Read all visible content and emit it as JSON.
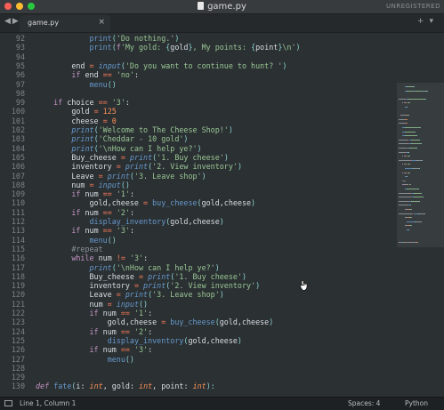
{
  "window": {
    "title": "game.py",
    "watermark": "UNREGISTERED"
  },
  "tabs": [
    {
      "label": "game.py",
      "close_glyph": "×"
    }
  ],
  "nav": {
    "back": "◀",
    "forward": "▶",
    "add": "+",
    "menu": "▾"
  },
  "editor": {
    "lines": [
      {
        "n": "92",
        "toks": [
          [
            "x",
            "            "
          ],
          [
            "fn",
            "print"
          ],
          [
            "par",
            "("
          ],
          [
            "str",
            "'Do nothing.'"
          ],
          [
            "par",
            ")"
          ]
        ]
      },
      {
        "n": "93",
        "toks": [
          [
            "x",
            "            "
          ],
          [
            "fn",
            "print"
          ],
          [
            "par",
            "("
          ],
          [
            "kw",
            "f"
          ],
          [
            "str",
            "'My gold: "
          ],
          [
            "par",
            "{"
          ],
          [
            "x",
            "gold"
          ],
          [
            "par",
            "}"
          ],
          [
            "str",
            ", My points: "
          ],
          [
            "par",
            "{"
          ],
          [
            "x",
            "point"
          ],
          [
            "par",
            "}"
          ],
          [
            "str",
            "\\n'"
          ],
          [
            "par",
            ")"
          ]
        ]
      },
      {
        "n": "94",
        "toks": []
      },
      {
        "n": "95",
        "toks": [
          [
            "x",
            "        end "
          ],
          [
            "op",
            "="
          ],
          [
            "x",
            " "
          ],
          [
            "bi",
            "input"
          ],
          [
            "par",
            "("
          ],
          [
            "str",
            "'Do you want to continue to hunt? '"
          ],
          [
            "par",
            ")"
          ]
        ]
      },
      {
        "n": "96",
        "toks": [
          [
            "x",
            "        "
          ],
          [
            "kw",
            "if"
          ],
          [
            "x",
            " end "
          ],
          [
            "op",
            "=="
          ],
          [
            "x",
            " "
          ],
          [
            "str",
            "'no'"
          ],
          [
            "x",
            ":"
          ]
        ]
      },
      {
        "n": "97",
        "toks": [
          [
            "x",
            "            "
          ],
          [
            "fn",
            "menu"
          ],
          [
            "par",
            "()"
          ]
        ]
      },
      {
        "n": "98",
        "toks": []
      },
      {
        "n": "99",
        "toks": [
          [
            "x",
            "    "
          ],
          [
            "kw",
            "if"
          ],
          [
            "x",
            " choice "
          ],
          [
            "op",
            "=="
          ],
          [
            "x",
            " "
          ],
          [
            "str",
            "'3'"
          ],
          [
            "x",
            ":"
          ]
        ]
      },
      {
        "n": "100",
        "toks": [
          [
            "x",
            "        gold "
          ],
          [
            "op",
            "="
          ],
          [
            "x",
            " "
          ],
          [
            "num",
            "125"
          ]
        ]
      },
      {
        "n": "101",
        "toks": [
          [
            "x",
            "        cheese "
          ],
          [
            "op",
            "="
          ],
          [
            "x",
            " "
          ],
          [
            "num",
            "0"
          ]
        ]
      },
      {
        "n": "102",
        "toks": [
          [
            "x",
            "        "
          ],
          [
            "bi",
            "print"
          ],
          [
            "par",
            "("
          ],
          [
            "str",
            "'Welcome to The Cheese Shop!'"
          ],
          [
            "par",
            ")"
          ]
        ]
      },
      {
        "n": "103",
        "toks": [
          [
            "x",
            "        "
          ],
          [
            "bi",
            "print"
          ],
          [
            "par",
            "("
          ],
          [
            "str",
            "'Cheddar - 10 gold'"
          ],
          [
            "par",
            ")"
          ]
        ]
      },
      {
        "n": "104",
        "toks": [
          [
            "x",
            "        "
          ],
          [
            "bi",
            "print"
          ],
          [
            "par",
            "("
          ],
          [
            "str",
            "'\\nHow can I help ye?'"
          ],
          [
            "par",
            ")"
          ]
        ]
      },
      {
        "n": "105",
        "toks": [
          [
            "x",
            "        Buy_cheese "
          ],
          [
            "op",
            "="
          ],
          [
            "x",
            " "
          ],
          [
            "bi",
            "print"
          ],
          [
            "par",
            "("
          ],
          [
            "str",
            "'1. Buy cheese'"
          ],
          [
            "par",
            ")"
          ]
        ]
      },
      {
        "n": "106",
        "toks": [
          [
            "x",
            "        inventory "
          ],
          [
            "op",
            "="
          ],
          [
            "x",
            " "
          ],
          [
            "bi",
            "print"
          ],
          [
            "par",
            "("
          ],
          [
            "str",
            "'2. View inventory'"
          ],
          [
            "par",
            ")"
          ]
        ]
      },
      {
        "n": "107",
        "toks": [
          [
            "x",
            "        Leave "
          ],
          [
            "op",
            "="
          ],
          [
            "x",
            " "
          ],
          [
            "bi",
            "print"
          ],
          [
            "par",
            "("
          ],
          [
            "str",
            "'3. Leave shop'"
          ],
          [
            "par",
            ")"
          ]
        ]
      },
      {
        "n": "108",
        "toks": [
          [
            "x",
            "        num "
          ],
          [
            "op",
            "="
          ],
          [
            "x",
            " "
          ],
          [
            "bi",
            "input"
          ],
          [
            "par",
            "()"
          ]
        ]
      },
      {
        "n": "109",
        "toks": [
          [
            "x",
            "        "
          ],
          [
            "kw",
            "if"
          ],
          [
            "x",
            " num "
          ],
          [
            "op",
            "=="
          ],
          [
            "x",
            " "
          ],
          [
            "str",
            "'1'"
          ],
          [
            "x",
            ":"
          ]
        ]
      },
      {
        "n": "110",
        "toks": [
          [
            "x",
            "            gold,cheese "
          ],
          [
            "op",
            "="
          ],
          [
            "x",
            " "
          ],
          [
            "fn",
            "buy_cheese"
          ],
          [
            "par",
            "("
          ],
          [
            "x",
            "gold,cheese"
          ],
          [
            "par",
            ")"
          ]
        ]
      },
      {
        "n": "111",
        "toks": [
          [
            "x",
            "        "
          ],
          [
            "kw",
            "if"
          ],
          [
            "x",
            " num "
          ],
          [
            "op",
            "=="
          ],
          [
            "x",
            " "
          ],
          [
            "str",
            "'2'"
          ],
          [
            "x",
            ":"
          ]
        ]
      },
      {
        "n": "112",
        "toks": [
          [
            "x",
            "            "
          ],
          [
            "fn",
            "display_inventory"
          ],
          [
            "par",
            "("
          ],
          [
            "x",
            "gold,cheese"
          ],
          [
            "par",
            ")"
          ]
        ]
      },
      {
        "n": "113",
        "toks": [
          [
            "x",
            "        "
          ],
          [
            "kw",
            "if"
          ],
          [
            "x",
            " num "
          ],
          [
            "op",
            "=="
          ],
          [
            "x",
            " "
          ],
          [
            "str",
            "'3'"
          ],
          [
            "x",
            ":"
          ]
        ]
      },
      {
        "n": "114",
        "toks": [
          [
            "x",
            "            "
          ],
          [
            "fn",
            "menu"
          ],
          [
            "par",
            "()"
          ]
        ]
      },
      {
        "n": "115",
        "toks": [
          [
            "x",
            "        "
          ],
          [
            "cm",
            "#repeat"
          ]
        ]
      },
      {
        "n": "116",
        "toks": [
          [
            "x",
            "        "
          ],
          [
            "kw",
            "while"
          ],
          [
            "x",
            " num "
          ],
          [
            "op",
            "!="
          ],
          [
            "x",
            " "
          ],
          [
            "str",
            "'3'"
          ],
          [
            "x",
            ":"
          ]
        ]
      },
      {
        "n": "117",
        "toks": [
          [
            "x",
            "            "
          ],
          [
            "bi",
            "print"
          ],
          [
            "par",
            "("
          ],
          [
            "str",
            "'\\nHow can I help ye?'"
          ],
          [
            "par",
            ")"
          ]
        ]
      },
      {
        "n": "118",
        "toks": [
          [
            "x",
            "            Buy_cheese "
          ],
          [
            "op",
            "="
          ],
          [
            "x",
            " "
          ],
          [
            "bi",
            "print"
          ],
          [
            "par",
            "("
          ],
          [
            "str",
            "'1. Buy cheese'"
          ],
          [
            "par",
            ")"
          ]
        ]
      },
      {
        "n": "119",
        "toks": [
          [
            "x",
            "            inventory "
          ],
          [
            "op",
            "="
          ],
          [
            "x",
            " "
          ],
          [
            "bi",
            "print"
          ],
          [
            "par",
            "("
          ],
          [
            "str",
            "'2. View inventory'"
          ],
          [
            "par",
            ")"
          ]
        ]
      },
      {
        "n": "120",
        "toks": [
          [
            "x",
            "            Leave "
          ],
          [
            "op",
            "="
          ],
          [
            "x",
            " "
          ],
          [
            "bi",
            "print"
          ],
          [
            "par",
            "("
          ],
          [
            "str",
            "'3. Leave shop'"
          ],
          [
            "par",
            ")"
          ]
        ]
      },
      {
        "n": "121",
        "toks": [
          [
            "x",
            "            num "
          ],
          [
            "op",
            "="
          ],
          [
            "x",
            " "
          ],
          [
            "bi",
            "input"
          ],
          [
            "par",
            "()"
          ]
        ]
      },
      {
        "n": "122",
        "toks": [
          [
            "x",
            "            "
          ],
          [
            "kw",
            "if"
          ],
          [
            "x",
            " num "
          ],
          [
            "op",
            "=="
          ],
          [
            "x",
            " "
          ],
          [
            "str",
            "'1'"
          ],
          [
            "x",
            ":"
          ]
        ]
      },
      {
        "n": "123",
        "toks": [
          [
            "x",
            "                gold,cheese "
          ],
          [
            "op",
            "="
          ],
          [
            "x",
            " "
          ],
          [
            "fn",
            "buy_cheese"
          ],
          [
            "par",
            "("
          ],
          [
            "x",
            "gold,cheese"
          ],
          [
            "par",
            ")"
          ]
        ]
      },
      {
        "n": "124",
        "toks": [
          [
            "x",
            "            "
          ],
          [
            "kw",
            "if"
          ],
          [
            "x",
            " num "
          ],
          [
            "op",
            "=="
          ],
          [
            "x",
            " "
          ],
          [
            "str",
            "'2'"
          ],
          [
            "x",
            ":"
          ]
        ]
      },
      {
        "n": "125",
        "toks": [
          [
            "x",
            "                "
          ],
          [
            "fn",
            "display_inventory"
          ],
          [
            "par",
            "("
          ],
          [
            "x",
            "gold,cheese"
          ],
          [
            "par",
            ")"
          ]
        ]
      },
      {
        "n": "126",
        "toks": [
          [
            "x",
            "            "
          ],
          [
            "kw",
            "if"
          ],
          [
            "x",
            " num "
          ],
          [
            "op",
            "=="
          ],
          [
            "x",
            " "
          ],
          [
            "str",
            "'3'"
          ],
          [
            "x",
            ":"
          ]
        ]
      },
      {
        "n": "127",
        "toks": [
          [
            "x",
            "                "
          ],
          [
            "fn",
            "menu"
          ],
          [
            "par",
            "()"
          ]
        ]
      },
      {
        "n": "128",
        "toks": []
      },
      {
        "n": "129",
        "toks": []
      },
      {
        "n": "130",
        "toks": [
          [
            "def",
            "def"
          ],
          [
            "x",
            " "
          ],
          [
            "nm",
            "fate"
          ],
          [
            "par",
            "("
          ],
          [
            "x",
            "i: "
          ],
          [
            "ty",
            "int"
          ],
          [
            "x",
            ", gold: "
          ],
          [
            "ty",
            "int"
          ],
          [
            "x",
            ", point: "
          ],
          [
            "ty",
            "int"
          ],
          [
            "par",
            "):"
          ]
        ]
      }
    ]
  },
  "status": {
    "position": "Line 1, Column 1",
    "indent": "Spaces: 4",
    "syntax": "Python"
  },
  "colors": {
    "background": "#2b3033",
    "keyword": "#c594c5",
    "function": "#6699cc",
    "string": "#99c794",
    "number": "#f99157",
    "operator": "#f97b58",
    "comment": "#8a9299"
  }
}
